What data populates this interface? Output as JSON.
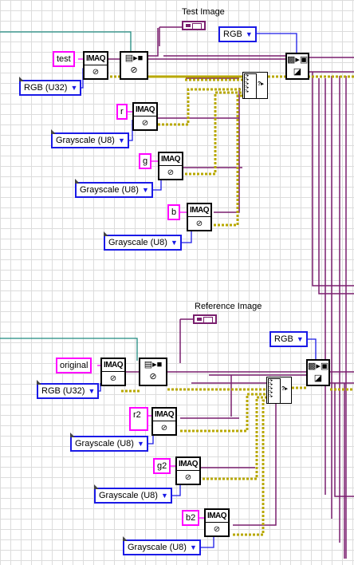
{
  "section_labels": {
    "test": "Test Image",
    "reference": "Reference Image"
  },
  "string_constants": {
    "test": "test",
    "r": "r",
    "g": "g",
    "b": "b",
    "original": "original",
    "r2": "r2",
    "g2": "g2",
    "b2": "b2"
  },
  "enums": {
    "test_type": "RGB (U32)",
    "r_type": "Grayscale (U8)",
    "g_type": "Grayscale (U8)",
    "b_type": "Grayscale (U8)",
    "test_color": "RGB",
    "ref_type": "RGB (U32)",
    "r2_type": "Grayscale (U8)",
    "g2_type": "Grayscale (U8)",
    "b2_type": "Grayscale (U8)",
    "ref_color": "RGB"
  },
  "imaq_label": "IMAQ",
  "dropdown_arrow": "▼",
  "icons": {
    "create": "imaq-create-icon",
    "file_read": "file-read-icon",
    "color_convert": "color-plane-icon",
    "indicator": "image-indicator-icon",
    "build_array": "build-array-icon"
  },
  "colors": {
    "string": "#ff00ff",
    "enum": "#1a1ae6",
    "image_wire": "#7a1f6e",
    "cluster_wire": "#b8a800",
    "teal_wire": "#1f8a80"
  }
}
